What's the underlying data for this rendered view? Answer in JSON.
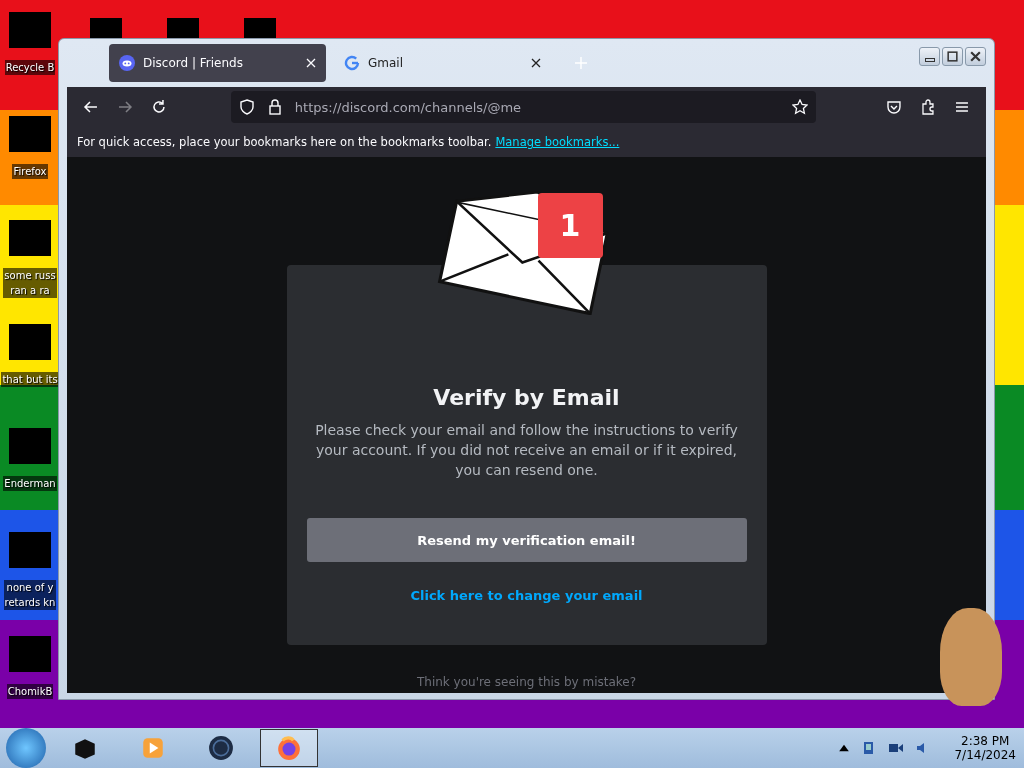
{
  "desktop": {
    "icons": [
      {
        "label": [
          "Recycle B"
        ]
      },
      {
        "label": [
          "Firefox"
        ]
      },
      {
        "label": [
          "some russ",
          "ran a ra"
        ]
      },
      {
        "label": [
          "that but its"
        ]
      },
      {
        "label": [
          "Enderman"
        ]
      },
      {
        "label": [
          "none of y",
          "retards kn"
        ]
      },
      {
        "label": [
          "ChomikB"
        ]
      }
    ]
  },
  "browser": {
    "tabs": [
      {
        "title": "Discord | Friends",
        "selected": true
      },
      {
        "title": "Gmail",
        "selected": false
      }
    ],
    "url": "https://discord.com/channels/@me",
    "bookmarks_hint": "For quick access, place your bookmarks here on the bookmarks toolbar.",
    "bookmarks_link": "Manage bookmarks..."
  },
  "page": {
    "badge": "1",
    "title": "Verify by Email",
    "message": "Please check your email and follow the instructions to verify your account. If you did not receive an email or if it expired, you can resend one.",
    "button": "Resend my verification email!",
    "link": "Click here to change your email",
    "footer": "Think you're seeing this by mistake?"
  },
  "taskbar": {
    "apps": [
      {
        "active": false
      },
      {
        "active": false
      },
      {
        "active": false
      },
      {
        "active": true
      }
    ],
    "time": "2:38 PM",
    "date": "7/14/2024"
  }
}
